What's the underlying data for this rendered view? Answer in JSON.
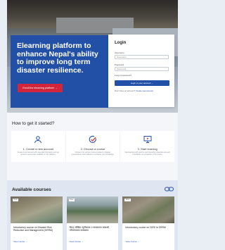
{
  "hero": {
    "title": "Elearning platform to enhance Nepal's ability to improve long term disaster resilience.",
    "button_label": "Enroll the elearning platform →"
  },
  "login": {
    "heading": "Login",
    "username_label": "Username",
    "username_placeholder": "Username",
    "password_label": "Password",
    "password_placeholder": "Password",
    "forgot_label": "Forgot password?",
    "login_button": "Login to your account →",
    "no_account": "Don't have an account?",
    "create_account": "Create new account"
  },
  "howto": {
    "title": "How to get it started?",
    "steps": [
      {
        "icon": "user-icon",
        "title": "1. Create a new account",
        "desc": "Create a new account with essential information and get access to all courses available on this platform."
      },
      {
        "icon": "check-circle-icon",
        "title": "2. Choose a course",
        "desc": "Choose from various courses related to disaster preparedness and resilience to enhance your knowledge."
      },
      {
        "icon": "monitor-icon",
        "title": "3. Start learning",
        "desc": "Start learning with quizzes and interactive materials and earn a certificate on completion of the course."
      }
    ]
  },
  "courses": {
    "title": "Available courses",
    "items": [
      {
        "tag": "Free",
        "title": "Introductory course on Disaster Risk Reduction and Management (DRRM)",
        "cta": "View course →",
        "thumb": "flood-aerial"
      },
      {
        "tag": "Free",
        "title": "विपद् जोखिम न्यूनीकरण र व्यवस्थापन सम्बन्धी परिचयात्मक पाठ्यक्रम",
        "cta": "View course →",
        "thumb": "flood-village"
      },
      {
        "tag": "Free",
        "title": "Introductory course on GESI in DRRM",
        "cta": "View course →",
        "thumb": "landslide"
      }
    ]
  },
  "colors": {
    "brand": "#2250a6",
    "accent": "#d3253a"
  }
}
